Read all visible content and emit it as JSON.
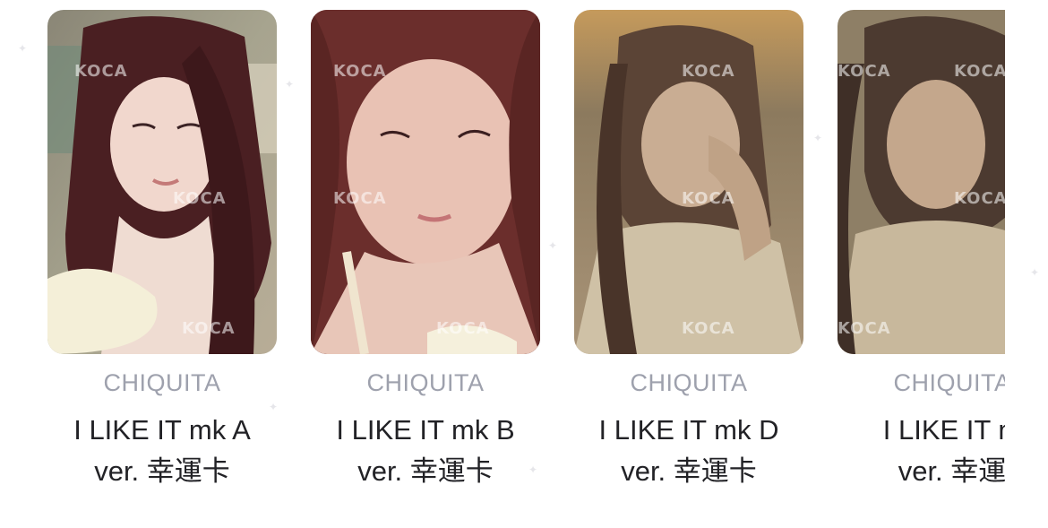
{
  "cards": [
    {
      "artist": "CHIQUITA",
      "title_line1": "I LIKE IT mk A",
      "title_line2": "ver. 幸運卡",
      "watermark": "KOCA"
    },
    {
      "artist": "CHIQUITA",
      "title_line1": "I LIKE IT mk B",
      "title_line2": "ver. 幸運卡",
      "watermark": "KOCA"
    },
    {
      "artist": "CHIQUITA",
      "title_line1": "I LIKE IT mk D",
      "title_line2": "ver. 幸運卡",
      "watermark": "KOCA"
    },
    {
      "artist": "CHIQUITA",
      "title_line1": "I LIKE IT m",
      "title_line2": "ver. 幸運",
      "watermark": "KOCA"
    }
  ],
  "colors": {
    "artist_text": "#9ea1ad",
    "title_text": "#222226",
    "background": "#ffffff"
  }
}
